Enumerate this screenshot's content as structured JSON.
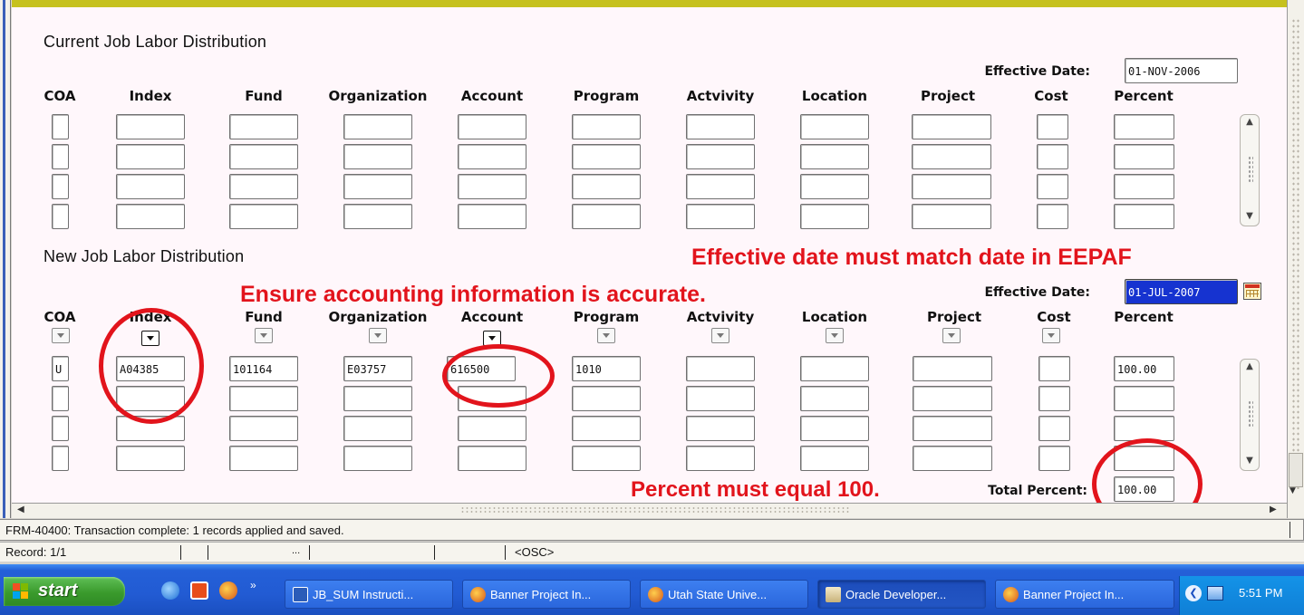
{
  "current": {
    "title": "Current Job Labor Distribution",
    "effective_date_label": "Effective Date:",
    "effective_date": "01-NOV-2006"
  },
  "new": {
    "title": "New Job Labor Distribution",
    "effective_date_label": "Effective Date:",
    "effective_date": "01-JUL-2007",
    "total_percent_label": "Total Percent:",
    "total_percent": "100.00"
  },
  "columns": [
    "COA",
    "Index",
    "Fund",
    "Organization",
    "Account",
    "Program",
    "Actvivity",
    "Location",
    "Project",
    "Cost",
    "Percent"
  ],
  "new_rows": [
    [
      "U",
      "A04385",
      "101164",
      "E03757",
      "616500",
      "1010",
      "",
      "",
      "",
      "",
      "100.00"
    ],
    [
      "",
      "",
      "",
      "",
      "",
      "",
      "",
      "",
      "",
      "",
      ""
    ],
    [
      "",
      "",
      "",
      "",
      "",
      "",
      "",
      "",
      "",
      "",
      ""
    ],
    [
      "",
      "",
      "",
      "",
      "",
      "",
      "",
      "",
      "",
      "",
      ""
    ]
  ],
  "annotations": {
    "effective_date_note": "Effective date must match date in EEPAF",
    "accounting_note": "Ensure accounting information is accurate.",
    "percent_note": "Percent must equal 100.",
    "color": "#e2141c"
  },
  "message": "FRM-40400: Transaction complete: 1 records applied and saved.",
  "status": {
    "record": "Record: 1/1",
    "ellipsis": "...",
    "mode": "<OSC>"
  },
  "taskbar": {
    "start_label": "start",
    "tasks": [
      {
        "label": "JB_SUM Instructi...",
        "icon": "word-doc-icon"
      },
      {
        "label": "Banner Project In...",
        "icon": "firefox-icon"
      },
      {
        "label": "Utah State Unive...",
        "icon": "firefox-icon"
      },
      {
        "label": "Oracle Developer...",
        "icon": "oracle-forms-icon"
      },
      {
        "label": "Banner Project In...",
        "icon": "firefox-icon"
      }
    ],
    "clock": "5:51 PM"
  },
  "colors": {
    "frame_top_bar": "#c6c11e",
    "canvas_bg": "#fff7fb",
    "selected_field": "#1633d0",
    "taskbar": "#225bd3"
  }
}
